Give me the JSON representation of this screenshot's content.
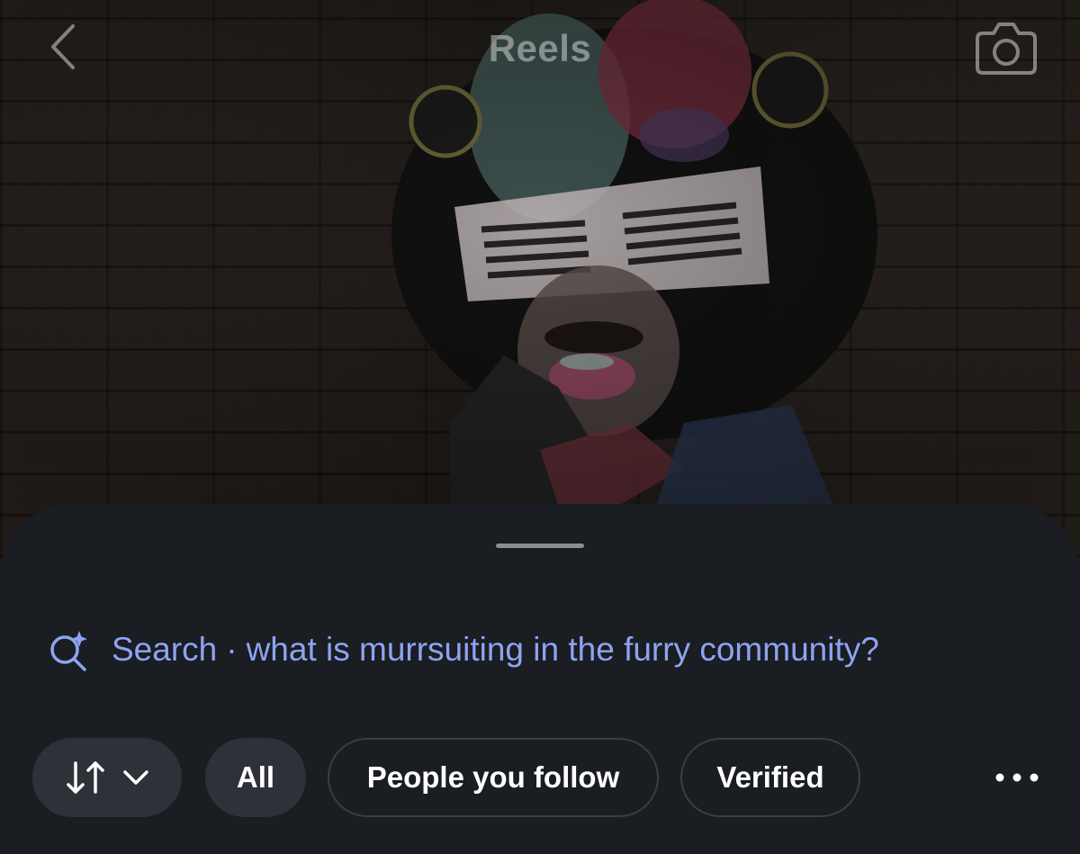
{
  "header": {
    "title": "Reels",
    "back_icon": "chevron-left-icon",
    "camera_icon": "camera-icon"
  },
  "background": {
    "description_icon": "video-frame"
  },
  "search": {
    "label": "Search",
    "separator": "·",
    "query": "what is murrsuiting in the furry community?",
    "icon": "ai-search-icon",
    "color": "#8ea3f2"
  },
  "filters": {
    "sort_icon": "sort-arrows-icon",
    "dropdown_icon": "chevron-down-icon",
    "chips": [
      {
        "label": "All",
        "style": "filled"
      },
      {
        "label": "People you follow",
        "style": "outline"
      },
      {
        "label": "Verified",
        "style": "outline"
      }
    ],
    "more_icon": "more-horizontal-icon"
  },
  "colors": {
    "sheet_background": "#1a1d21",
    "chip_filled": "#2e3238",
    "chip_border": "#3a3e44",
    "accent": "#8ea3f2"
  }
}
